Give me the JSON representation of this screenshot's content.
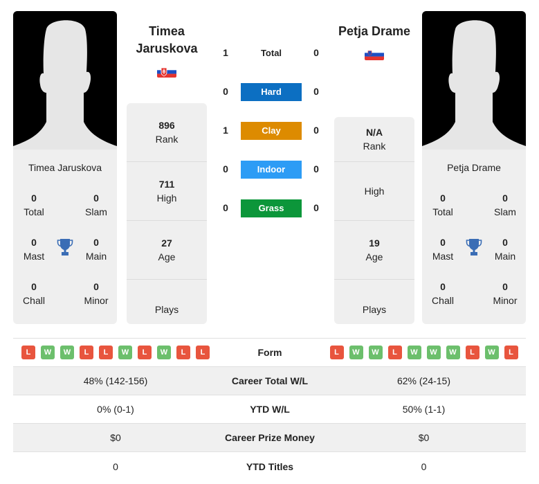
{
  "colors": {
    "hard": "#0c6fc2",
    "clay": "#dd8b00",
    "indoor": "#2d9cf5",
    "grass": "#0c963a",
    "win": "#6cbf6c",
    "loss": "#e8553e",
    "trophy": "#3a6db5"
  },
  "player1": {
    "name": "Timea Jaruskova",
    "name_line1": "Timea",
    "name_line2": "Jaruskova",
    "flag": "Slovakia",
    "rank": "896",
    "rank_label": "Rank",
    "high": "711",
    "high_label": "High",
    "age": "27",
    "age_label": "Age",
    "plays_label": "Plays",
    "titles": {
      "total": "0",
      "total_label": "Total",
      "slam": "0",
      "slam_label": "Slam",
      "mast": "0",
      "mast_label": "Mast",
      "main": "0",
      "main_label": "Main",
      "chall": "0",
      "chall_label": "Chall",
      "minor": "0",
      "minor_label": "Minor"
    },
    "form": [
      "L",
      "W",
      "W",
      "L",
      "L",
      "W",
      "L",
      "W",
      "L",
      "L"
    ],
    "career_wl": "48% (142-156)",
    "ytd_wl": "0% (0-1)",
    "prize": "$0",
    "ytd_titles": "0"
  },
  "player2": {
    "name": "Petja Drame",
    "flag": "Slovenia",
    "rank": "N/A",
    "rank_label": "Rank",
    "high_label": "High",
    "age": "19",
    "age_label": "Age",
    "plays_label": "Plays",
    "titles": {
      "total": "0",
      "total_label": "Total",
      "slam": "0",
      "slam_label": "Slam",
      "mast": "0",
      "mast_label": "Mast",
      "main": "0",
      "main_label": "Main",
      "chall": "0",
      "chall_label": "Chall",
      "minor": "0",
      "minor_label": "Minor"
    },
    "form": [
      "L",
      "W",
      "W",
      "L",
      "W",
      "W",
      "W",
      "L",
      "W",
      "L"
    ],
    "career_wl": "62% (24-15)",
    "ytd_wl": "50% (1-1)",
    "prize": "$0",
    "ytd_titles": "0"
  },
  "h2h": [
    {
      "label": "Total",
      "p1": "1",
      "p2": "0"
    },
    {
      "label": "Hard",
      "p1": "0",
      "p2": "0"
    },
    {
      "label": "Clay",
      "p1": "1",
      "p2": "0"
    },
    {
      "label": "Indoor",
      "p1": "0",
      "p2": "0"
    },
    {
      "label": "Grass",
      "p1": "0",
      "p2": "0"
    }
  ],
  "compare_labels": {
    "form": "Form",
    "career_wl": "Career Total W/L",
    "ytd_wl": "YTD W/L",
    "prize": "Career Prize Money",
    "ytd_titles": "YTD Titles"
  }
}
